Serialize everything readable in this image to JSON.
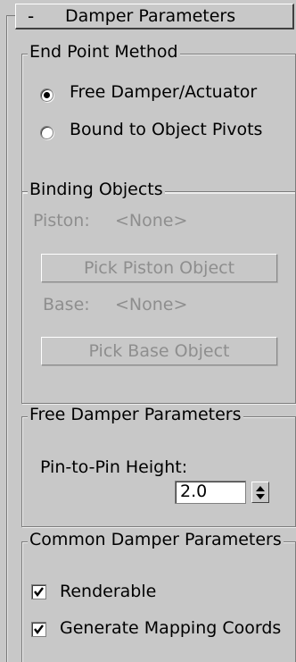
{
  "rollout": {
    "collapse_glyph": "-",
    "title": "Damper Parameters"
  },
  "end_point_method": {
    "legend": "End Point Method",
    "options": [
      {
        "label": "Free Damper/Actuator",
        "checked": true
      },
      {
        "label": "Bound to Object Pivots",
        "checked": false
      }
    ]
  },
  "binding_objects": {
    "legend": "Binding Objects",
    "piston_label": "Piston:",
    "piston_value": "<None>",
    "pick_piston_label": "Pick Piston Object",
    "base_label": "Base:",
    "base_value": "<None>",
    "pick_base_label": "Pick Base Object"
  },
  "free_damper": {
    "legend": "Free Damper Parameters",
    "height_label": "Pin-to-Pin Height:",
    "height_value": "2.0",
    "spinner_icon": "up-down-spinner-icon"
  },
  "common_damper": {
    "legend": "Common Damper Parameters",
    "renderable_label": "Renderable",
    "renderable_checked": true,
    "mapping_label": "Generate Mapping Coords",
    "mapping_checked": true
  },
  "colors": {
    "panel_bg": "#c8c8c8",
    "disabled_text": "#8e8e8e",
    "border_dark": "#7d7d7d",
    "highlight": "#eeeeee"
  }
}
